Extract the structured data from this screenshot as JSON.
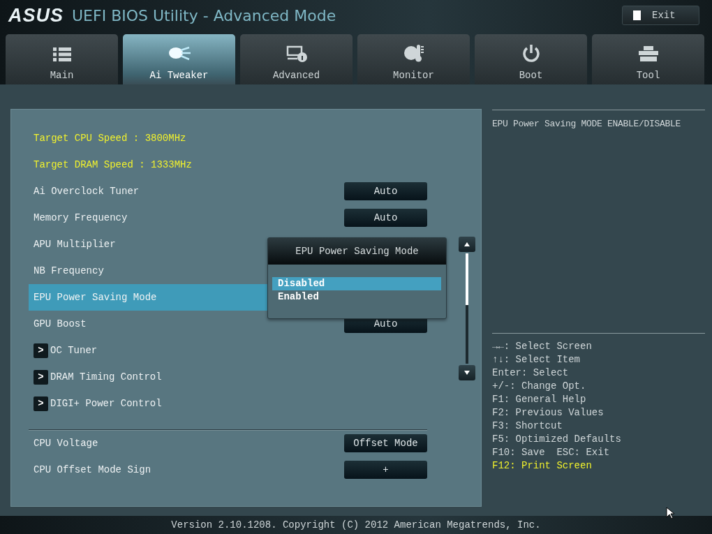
{
  "header": {
    "logo": "ASUS",
    "title": "UEFI BIOS Utility - Advanced Mode",
    "exit_button": "Exit"
  },
  "tabs": [
    {
      "label": "Main",
      "selected": false
    },
    {
      "label": "Ai Tweaker",
      "selected": true
    },
    {
      "label": "Advanced",
      "selected": false
    },
    {
      "label": "Monitor",
      "selected": false
    },
    {
      "label": "Boot",
      "selected": false
    },
    {
      "label": "Tool",
      "selected": false
    }
  ],
  "settings": [
    {
      "kind": "info",
      "label": "Target CPU Speed : 3800MHz",
      "selected": false
    },
    {
      "kind": "info",
      "label": "Target DRAM Speed : 1333MHz",
      "selected": false
    },
    {
      "kind": "setting",
      "label": "Ai Overclock Tuner",
      "value": "Auto",
      "selected": false
    },
    {
      "kind": "setting",
      "label": "Memory Frequency",
      "value": "Auto",
      "selected": false
    },
    {
      "kind": "setting",
      "label": "APU Multiplier",
      "selected": false
    },
    {
      "kind": "setting",
      "label": "NB Frequency",
      "selected": false
    },
    {
      "kind": "setting",
      "label": "EPU Power Saving Mode",
      "selected": true
    },
    {
      "kind": "setting",
      "label": "GPU Boost",
      "value": "Auto",
      "selected": false
    },
    {
      "kind": "submenu",
      "label": "OC Tuner",
      "arrow": ">",
      "selected": false
    },
    {
      "kind": "submenu",
      "label": "DRAM Timing Control",
      "arrow": ">",
      "selected": false
    },
    {
      "kind": "submenu",
      "label": "DIGI+ Power Control",
      "arrow": ">",
      "selected": false
    },
    {
      "kind": "divider"
    },
    {
      "kind": "setting",
      "label": "CPU Voltage",
      "value": "Offset Mode",
      "selected": false
    },
    {
      "kind": "setting",
      "label": "CPU Offset Mode Sign",
      "value": "+",
      "selected": false
    }
  ],
  "popup": {
    "title": "EPU Power Saving Mode",
    "options": [
      {
        "label": "Disabled",
        "selected": true
      },
      {
        "label": "Enabled",
        "selected": false
      }
    ]
  },
  "help": {
    "description": "EPU Power Saving MODE ENABLE/DISABLE",
    "keys": [
      {
        "text": "→←: Select Screen",
        "highlighted": false
      },
      {
        "text": "↑↓: Select Item",
        "highlighted": false
      },
      {
        "text": "Enter: Select",
        "highlighted": false
      },
      {
        "text": "+/-: Change Opt.",
        "highlighted": false
      },
      {
        "text": "F1: General Help",
        "highlighted": false
      },
      {
        "text": "F2: Previous Values",
        "highlighted": false
      },
      {
        "text": "F3: Shortcut",
        "highlighted": false
      },
      {
        "text": "F5: Optimized Defaults",
        "highlighted": false
      },
      {
        "text": "F10: Save  ESC: Exit",
        "highlighted": false
      },
      {
        "text": "F12: Print Screen",
        "highlighted": true
      }
    ]
  },
  "footer": "Version 2.10.1208. Copyright (C) 2012 American Megatrends, Inc."
}
